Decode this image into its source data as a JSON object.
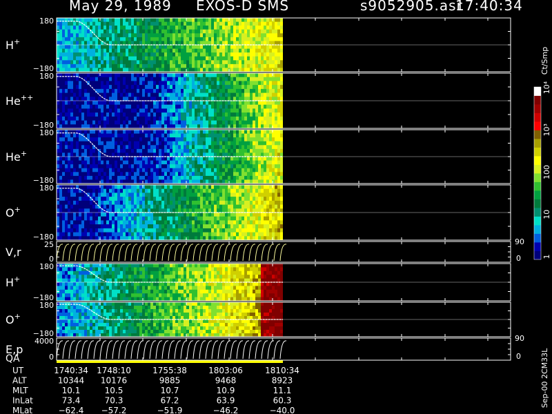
{
  "header": {
    "date": "May 29, 1989",
    "instrument": "EXOS-D SMS",
    "file": "s9052905.asr",
    "time": "17:40:34"
  },
  "colorbar": {
    "unit": "Ct/Smp",
    "tick_labels": [
      "1",
      "10",
      "100",
      "10³",
      "10⁴"
    ],
    "colors": [
      "#00007a",
      "#0000b0",
      "#0060e0",
      "#00b0e0",
      "#00e0c8",
      "#009070",
      "#007a3c",
      "#00a040",
      "#30c030",
      "#80e030",
      "#d8f020",
      "#ffff00",
      "#d0d000",
      "#a8a000",
      "#806000",
      "#ff0000",
      "#d00000",
      "#a00000",
      "#800000",
      "#ffffff"
    ]
  },
  "panels": [
    {
      "id": "H+",
      "label": "H",
      "sup": "+",
      "y_top": "180",
      "y_bottom": "−180"
    },
    {
      "id": "He++",
      "label": "He",
      "sup": "++",
      "y_top": "180",
      "y_bottom": "−180"
    },
    {
      "id": "He+",
      "label": "He",
      "sup": "+",
      "y_top": "180",
      "y_bottom": "−180"
    },
    {
      "id": "O+",
      "label": "O",
      "sup": "+",
      "y_top": "180",
      "y_bottom": "−180"
    },
    {
      "id": "Vr",
      "label": "V,r",
      "sup": "",
      "y_top": "25",
      "y_bottom": "0",
      "right_top": "90",
      "right_bottom": "0"
    },
    {
      "id": "H+b",
      "label": "H",
      "sup": "+",
      "y_top": "180",
      "y_bottom": "−180"
    },
    {
      "id": "O+b",
      "label": "O",
      "sup": "+",
      "y_top": "180",
      "y_bottom": "−180"
    },
    {
      "id": "Ep",
      "label": "E,p",
      "sup": "",
      "y_top": "4000",
      "y_bottom": "0",
      "right_top": "90",
      "right_bottom": "0"
    }
  ],
  "qa_label": "QA",
  "orbit_table": {
    "row_labels": [
      "UT",
      "ALT",
      "MLT",
      "InLat",
      "MLat"
    ],
    "columns": [
      [
        "1740:34",
        "10344",
        "10.1",
        "73.4",
        "−62.4"
      ],
      [
        "1748:10",
        "10176",
        "10.5",
        "70.3",
        "−57.2"
      ],
      [
        "1755:38",
        "9885",
        "10.7",
        "67.2",
        "−51.9"
      ],
      [
        "1803:06",
        "9468",
        "10.9",
        "63.9",
        "−46.2"
      ],
      [
        "1810:34",
        "8923",
        "11.1",
        "60.3",
        "−40.0"
      ]
    ]
  },
  "footer_vertical": "Sep-00 2CM33L",
  "chart_data": {
    "type": "heatmap",
    "title": "May 29, 1989   EXOS-D SMS",
    "x": [
      "1740:34",
      "1748:10",
      "1755:38",
      "1803:06",
      "1810:34"
    ],
    "colorbar_unit": "Ct/Smp",
    "colorbar_scale": "log",
    "colorbar_range": [
      1,
      10000
    ],
    "grid": true,
    "series": [
      {
        "name": "H+"
      },
      {
        "name": "He++"
      },
      {
        "name": "He+"
      },
      {
        "name": "O+"
      },
      {
        "name": "V,r"
      },
      {
        "name": "H+"
      },
      {
        "name": "O+"
      },
      {
        "name": "E,p"
      }
    ]
  }
}
